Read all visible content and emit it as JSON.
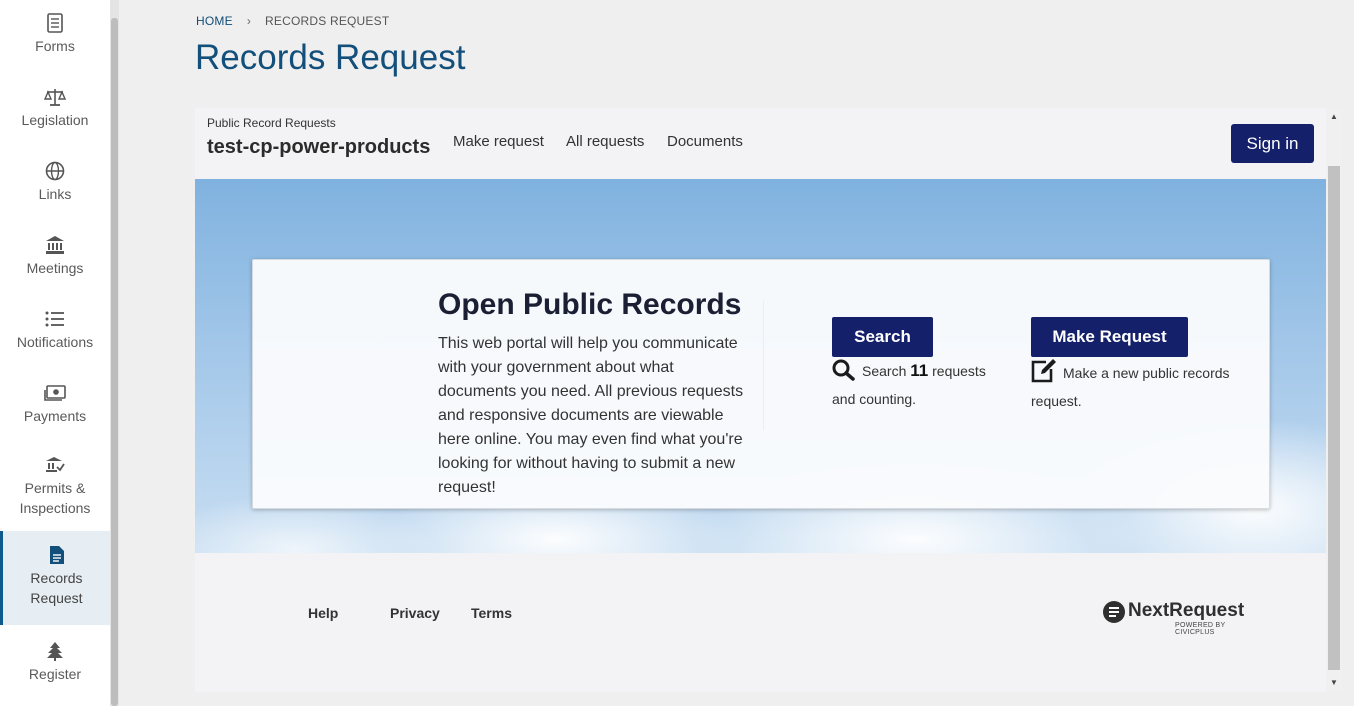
{
  "sidebar": {
    "items": [
      {
        "label": "Forms",
        "icon": "form-icon"
      },
      {
        "label": "Legislation",
        "icon": "scale-icon"
      },
      {
        "label": "Links",
        "icon": "globe-icon"
      },
      {
        "label": "Meetings",
        "icon": "bank-icon"
      },
      {
        "label": "Notifications",
        "icon": "list-icon"
      },
      {
        "label": "Payments",
        "icon": "money-icon"
      },
      {
        "label": "Permits &\nInspections",
        "icon": "permit-icon"
      },
      {
        "label": "Records\nRequest",
        "icon": "document-icon",
        "active": true
      },
      {
        "label": "Register",
        "icon": "tree-icon"
      }
    ]
  },
  "breadcrumb": {
    "home": "HOME",
    "current": "RECORDS REQUEST"
  },
  "page_title": "Records Request",
  "portal": {
    "small_title": "Public Record Requests",
    "site_name": "test-cp-power-products",
    "nav": [
      "Make request",
      "All requests",
      "Documents"
    ],
    "signin": "Sign in"
  },
  "hero": {
    "title": "Open Public Records",
    "description": "This web portal will help you communicate with your government about what documents you need. All previous requests and responsive documents are viewable here online. You may even find what you're looking for without having to submit a new request!",
    "search_button": "Search",
    "search_caption_pre": "Search",
    "search_count": "11",
    "search_caption_post": "requests and counting.",
    "request_button": "Make Request",
    "request_caption": "Make a new public records request."
  },
  "footer": {
    "links": [
      "Help",
      "Privacy",
      "Terms"
    ],
    "brand_name": "NextRequest",
    "brand_sub": "POWERED BY CIVICPLUS"
  },
  "colors": {
    "primary": "#15206b",
    "title": "#134f7b"
  }
}
